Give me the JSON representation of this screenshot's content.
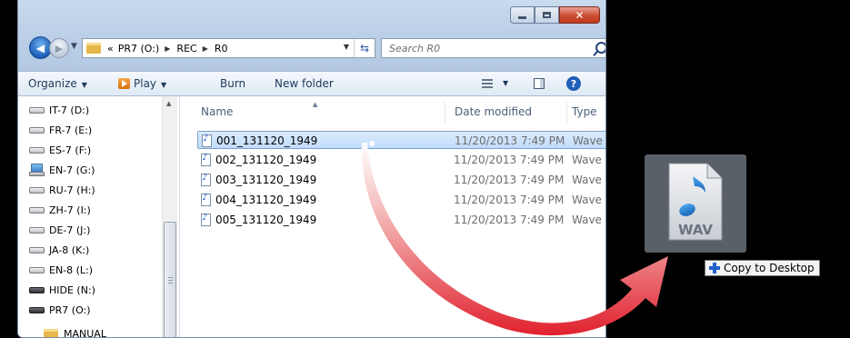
{
  "window": {
    "caption_buttons": [
      "minimize",
      "maximize",
      "close"
    ]
  },
  "address": {
    "overflow": "«",
    "crumbs": [
      "PR7 (O:)",
      "REC",
      "R0"
    ]
  },
  "search": {
    "placeholder": "Search R0"
  },
  "toolbar": {
    "organize": "Organize",
    "play": "Play",
    "burn": "Burn",
    "new_folder": "New folder"
  },
  "nav": {
    "items": [
      {
        "label": "IT-7 (D:)",
        "icon": "drive-icon"
      },
      {
        "label": "FR-7 (E:)",
        "icon": "drive-icon"
      },
      {
        "label": "ES-7 (F:)",
        "icon": "drive-icon"
      },
      {
        "label": "EN-7 (G:)",
        "icon": "network-drive-icon"
      },
      {
        "label": "RU-7 (H:)",
        "icon": "drive-icon"
      },
      {
        "label": "ZH-7 (I:)",
        "icon": "drive-icon"
      },
      {
        "label": "DE-7 (J:)",
        "icon": "drive-icon"
      },
      {
        "label": "JA-8 (K:)",
        "icon": "drive-icon"
      },
      {
        "label": "EN-8 (L:)",
        "icon": "drive-icon"
      },
      {
        "label": "HIDE (N:)",
        "icon": "dark-drive-icon"
      },
      {
        "label": "PR7 (O:)",
        "icon": "dark-drive-icon"
      },
      {
        "label": "MANUAL",
        "icon": "folder-icon"
      }
    ]
  },
  "columns": {
    "name": "Name",
    "date": "Date modified",
    "type": "Type"
  },
  "files": [
    {
      "name": "001_131120_1949",
      "date": "11/20/2013 7:49 PM",
      "type": "Wave",
      "selected": true
    },
    {
      "name": "002_131120_1949",
      "date": "11/20/2013 7:49 PM",
      "type": "Wave",
      "selected": false
    },
    {
      "name": "003_131120_1949",
      "date": "11/20/2013 7:49 PM",
      "type": "Wave",
      "selected": false
    },
    {
      "name": "004_131120_1949",
      "date": "11/20/2013 7:49 PM",
      "type": "Wave",
      "selected": false
    },
    {
      "name": "005_131120_1949",
      "date": "11/20/2013 7:49 PM",
      "type": "Wave",
      "selected": false
    }
  ],
  "drag": {
    "file_label": "WAV",
    "tooltip": "Copy to Desktop"
  },
  "colors": {
    "arrow": "#e02a35",
    "selection": "#c1dcfc",
    "accent": "#1f5fb8"
  }
}
